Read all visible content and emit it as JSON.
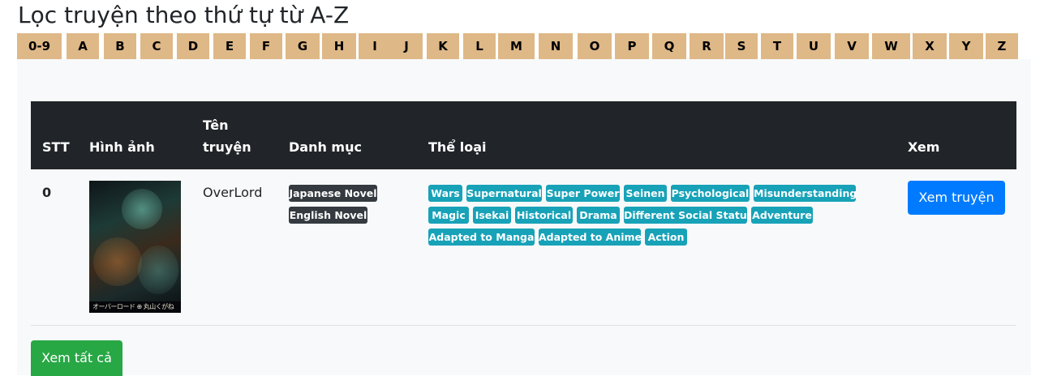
{
  "page": {
    "title": "Lọc truyện theo thứ tự từ A-Z"
  },
  "letters": [
    "0-9",
    "A",
    "B",
    "C",
    "D",
    "E",
    "F",
    "G",
    "H",
    "I",
    "J",
    "K",
    "L",
    "M",
    "N",
    "O",
    "P",
    "Q",
    "R",
    "S",
    "T",
    "U",
    "V",
    "W",
    "X",
    "Y",
    "Z"
  ],
  "table": {
    "headers": {
      "stt": "STT",
      "image": "Hình ảnh",
      "name_line1": "Tên",
      "name_line2": "truyện",
      "category": "Danh mục",
      "genre": "Thể loại",
      "view": "Xem"
    },
    "rows": [
      {
        "stt": "0",
        "cover_text": "オーバーロード ⊕ 丸山くがね",
        "name": "OverLord",
        "categories": [
          "Japanese Novel",
          "English Novel"
        ],
        "genres": [
          "Wars",
          "Supernatural",
          "Super Power",
          "Seinen",
          "Psychological",
          "Misunderstanding",
          "Magic",
          "Isekai",
          "Historical",
          "Drama",
          "Different Social Status",
          "Adventure",
          "Adapted to Manga",
          "Adapted to Anime",
          "Action"
        ],
        "view_button": "Xem truyện"
      }
    ]
  },
  "footer": {
    "view_all": "Xem tất cả"
  },
  "colors": {
    "letter_bg": "#deb887",
    "header_bg": "#212529",
    "category_badge": "#343a40",
    "genre_badge": "#17a2b8",
    "primary_button": "#007bff",
    "success_button": "#28a745"
  }
}
